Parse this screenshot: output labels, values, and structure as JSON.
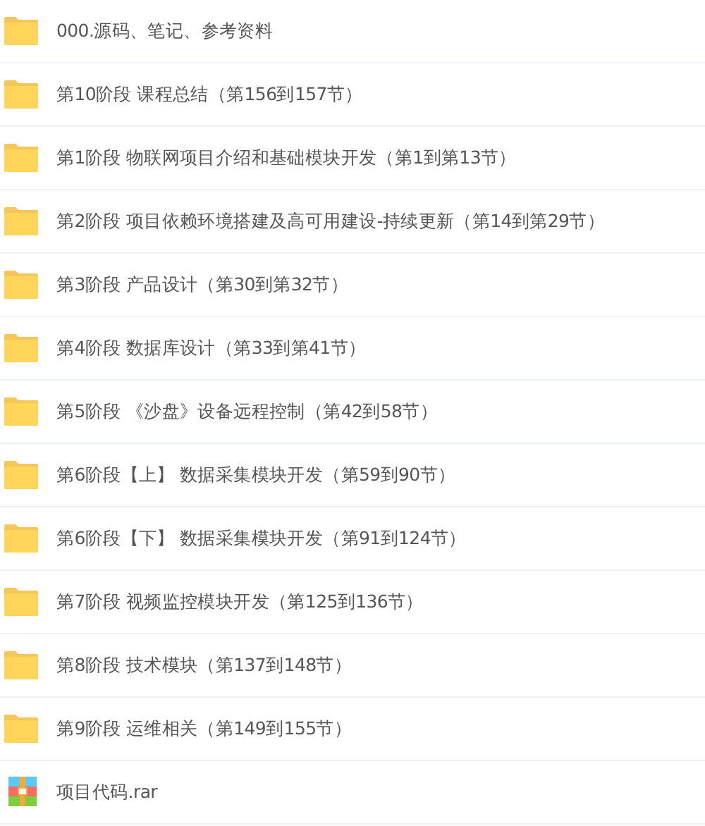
{
  "files": [
    {
      "kind": "folder",
      "name": "000.源码、笔记、参考资料"
    },
    {
      "kind": "folder",
      "name": "第10阶段 课程总结（第156到157节）"
    },
    {
      "kind": "folder",
      "name": "第1阶段 物联网项目介绍和基础模块开发（第1到第13节）"
    },
    {
      "kind": "folder",
      "name": "第2阶段 项目依赖环境搭建及高可用建设-持续更新（第14到第29节）"
    },
    {
      "kind": "folder",
      "name": "第3阶段 产品设计（第30到第32节）"
    },
    {
      "kind": "folder",
      "name": "第4阶段 数据库设计（第33到第41节）"
    },
    {
      "kind": "folder",
      "name": "第5阶段 《沙盘》设备远程控制（第42到58节）"
    },
    {
      "kind": "folder",
      "name": "第6阶段【上】 数据采集模块开发（第59到90节）"
    },
    {
      "kind": "folder",
      "name": "第6阶段【下】 数据采集模块开发（第91到124节）"
    },
    {
      "kind": "folder",
      "name": "第7阶段 视频监控模块开发（第125到136节）"
    },
    {
      "kind": "folder",
      "name": "第8阶段 技术模块（第137到148节）"
    },
    {
      "kind": "folder",
      "name": "第9阶段 运维相关（第149到155节）"
    },
    {
      "kind": "archive",
      "name": "项目代码.rar"
    }
  ]
}
